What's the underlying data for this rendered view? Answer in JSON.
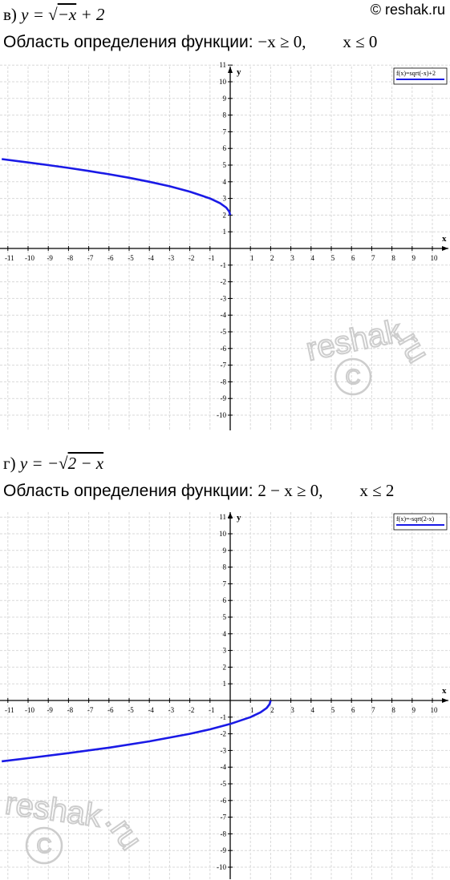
{
  "copyright": "© reshak.ru",
  "watermark": {
    "text": "reshak.ru",
    "symbol": "©"
  },
  "colors": {
    "curve": "#1a1ae6",
    "grid": "#d9d9d9",
    "axis": "#000000"
  },
  "parts": [
    {
      "label": "в)",
      "formula_lhs": "y = ",
      "formula_radical": "−x",
      "formula_rest": " + 2",
      "domain_text": "Область определения функции:",
      "domain_condition": "−x ≥ 0,",
      "domain_result": "x ≤ 0"
    },
    {
      "label": "г)",
      "formula_lhs": "y = −",
      "formula_radical": "2 − x",
      "formula_rest": "",
      "domain_text": "Область определения функции:",
      "domain_condition": "2 − x ≥ 0,",
      "domain_result": "x ≤ 2"
    }
  ],
  "chart_data": [
    {
      "type": "line",
      "legend": "f(x)=sqrt(-x)+2",
      "legend_position": "top-right",
      "xlabel": "x",
      "ylabel": "y",
      "xlim": [
        -11.3,
        11
      ],
      "ylim": [
        -10.7,
        11.5
      ],
      "grid": true,
      "x_ticks": [
        -11,
        -10,
        -9,
        -8,
        -7,
        -6,
        -5,
        -4,
        -3,
        -2,
        -1,
        1,
        2,
        3,
        4,
        5,
        6,
        7,
        8,
        9,
        10
      ],
      "y_ticks": [
        11,
        10,
        9,
        8,
        7,
        6,
        5,
        4,
        3,
        2,
        1,
        -1,
        -2,
        -3,
        -4,
        -5,
        -6,
        -7,
        -8,
        -9,
        -10
      ],
      "series": [
        {
          "name": "f(x)=sqrt(-x)+2",
          "x": [
            -11.3,
            -10,
            -9,
            -8,
            -7,
            -6,
            -5,
            -4,
            -3,
            -2,
            -1,
            -0.5,
            -0.2,
            -0.05,
            0
          ],
          "y": [
            5.36,
            5.16,
            5.0,
            4.83,
            4.65,
            4.45,
            4.24,
            4.0,
            3.73,
            3.41,
            3.0,
            2.71,
            2.45,
            2.22,
            2.0
          ]
        }
      ]
    },
    {
      "type": "line",
      "legend": "f(x)=-sqrt(2-x)",
      "legend_position": "top-right",
      "xlabel": "x",
      "ylabel": "y",
      "xlim": [
        -11.3,
        11
      ],
      "ylim": [
        -10.7,
        11.5
      ],
      "grid": true,
      "x_ticks": [
        -11,
        -10,
        -9,
        -8,
        -7,
        -6,
        -5,
        -4,
        -3,
        -2,
        -1,
        1,
        2,
        3,
        4,
        5,
        6,
        7,
        8,
        9,
        10
      ],
      "y_ticks": [
        11,
        10,
        9,
        8,
        7,
        6,
        5,
        4,
        3,
        2,
        1,
        -1,
        -2,
        -3,
        -4,
        -5,
        -6,
        -7,
        -8,
        -9,
        -10
      ],
      "series": [
        {
          "name": "f(x)=-sqrt(2-x)",
          "x": [
            -11.3,
            -10,
            -8,
            -6,
            -4,
            -2,
            -1,
            0,
            1,
            1.5,
            1.8,
            1.95,
            2
          ],
          "y": [
            -3.65,
            -3.46,
            -3.16,
            -2.83,
            -2.45,
            -2.0,
            -1.73,
            -1.41,
            -1.0,
            -0.71,
            -0.45,
            -0.22,
            0.0
          ]
        }
      ]
    }
  ]
}
